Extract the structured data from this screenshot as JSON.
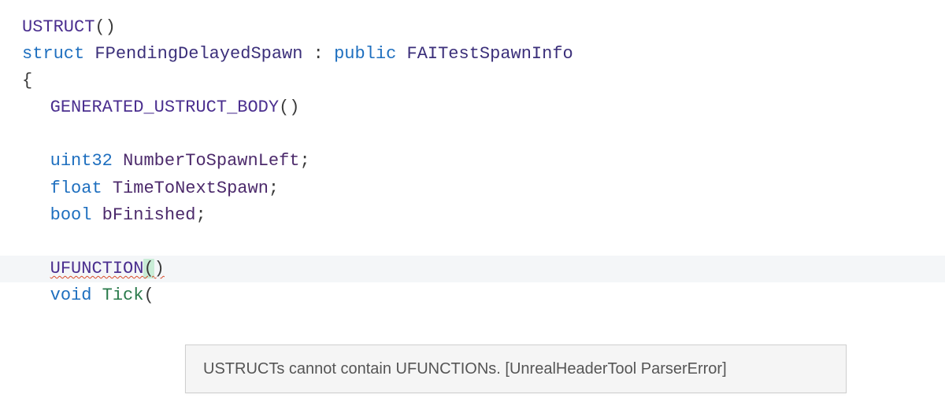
{
  "code": {
    "ustruct_macro": "USTRUCT",
    "struct_kw": "struct",
    "struct_name": "FPendingDelayedSpawn",
    "inherit_punct": " : ",
    "public_kw": "public",
    "base_name": "FAITestSpawnInfo",
    "open_brace": "{",
    "gen_body_macro": "GENERATED_USTRUCT_BODY",
    "parens": "()",
    "uint32_kw": "uint32",
    "member1": "NumberToSpawnLeft",
    "float_kw": "float",
    "member2": "TimeToNextSpawn",
    "bool_kw": "bool",
    "member3": "bFinished",
    "ufunction_macro": "UFUNCTION",
    "uf_open": "(",
    "uf_close": ")",
    "void_kw": "void",
    "tick_fn": "Tick",
    "tick_open": "(",
    "semicolon": ";"
  },
  "tooltip": {
    "text": "USTRUCTs cannot contain UFUNCTIONs. [UnrealHeaderTool ParserError]"
  }
}
